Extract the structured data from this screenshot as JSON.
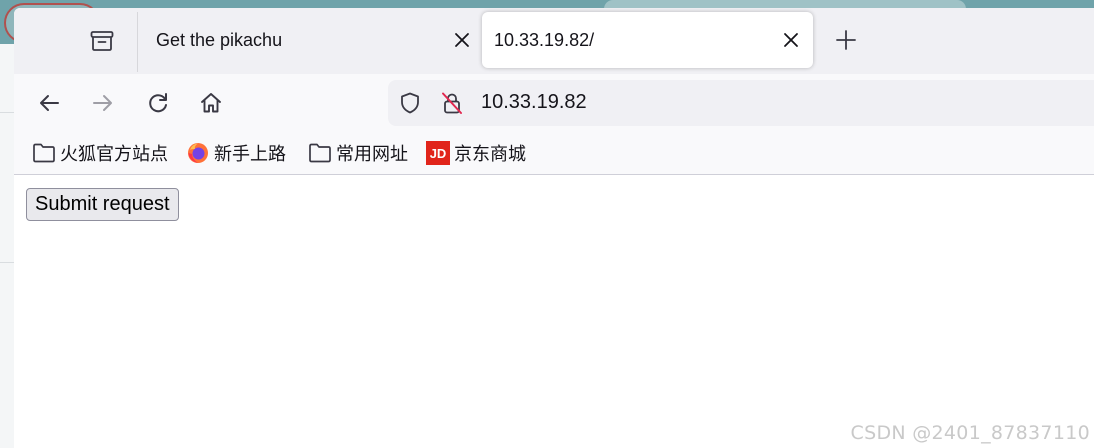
{
  "tabs": [
    {
      "title": "Get the pikachu",
      "active": false
    },
    {
      "title": "10.33.19.82/",
      "active": true
    }
  ],
  "urlbar": {
    "url": "10.33.19.82"
  },
  "bookmarks": [
    {
      "label": "火狐官方站点",
      "icon": "folder-icon"
    },
    {
      "label": "新手上路",
      "icon": "firefox-icon"
    },
    {
      "label": "常用网址",
      "icon": "folder-icon"
    },
    {
      "label": "京东商城",
      "icon": "jd-icon"
    }
  ],
  "page": {
    "submit_label": "Submit request"
  },
  "watermark": "CSDN @2401_87837110",
  "colors": {
    "accent_jd": "#e1251b",
    "toolbar_bg": "#f9f9fb",
    "tabbar_bg": "#f0f0f4"
  }
}
